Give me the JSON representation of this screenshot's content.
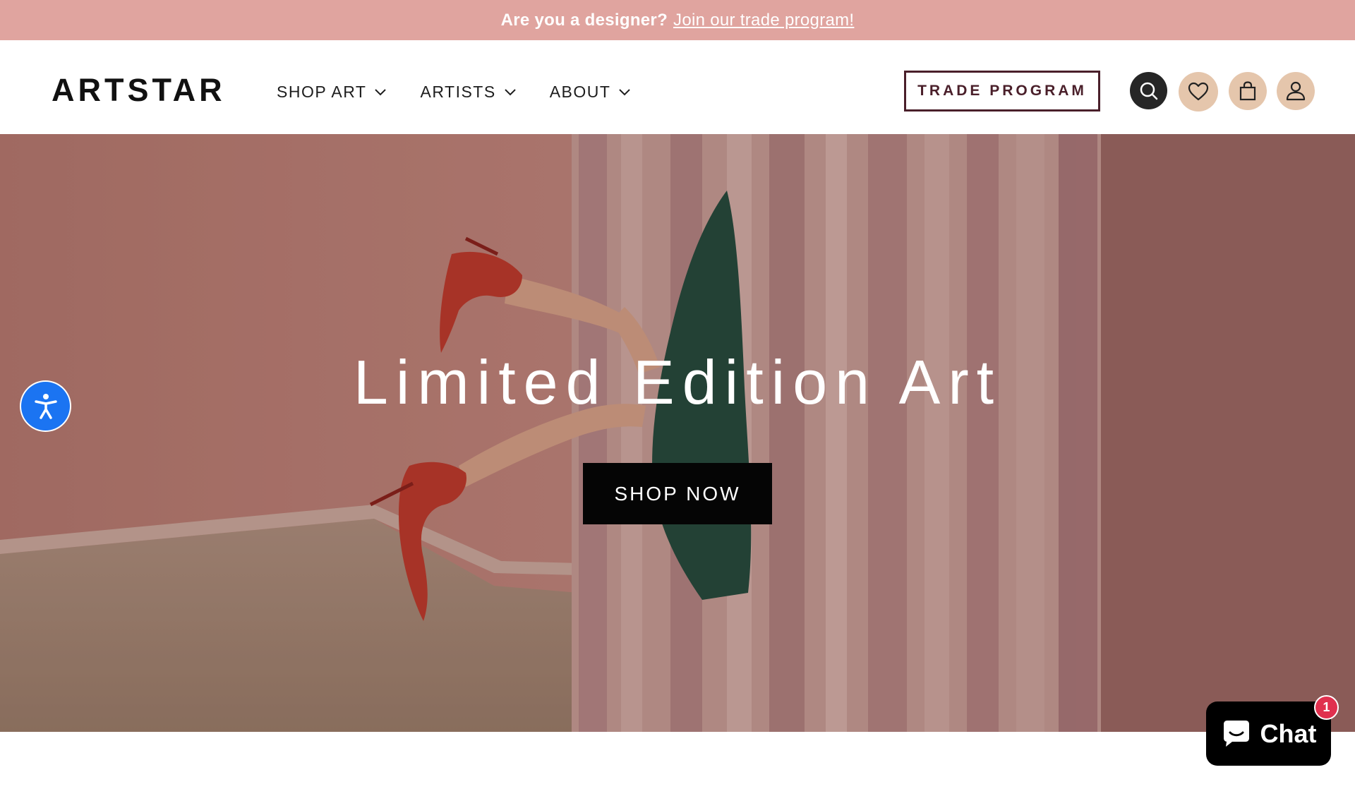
{
  "announcement": {
    "text": "Are you a designer?",
    "link": "Join our trade program!"
  },
  "header": {
    "logo": "ARTSTAR",
    "nav": [
      {
        "label": "SHOP ART"
      },
      {
        "label": "ARTISTS"
      },
      {
        "label": "ABOUT"
      }
    ],
    "trade_button": "TRADE PROGRAM",
    "icons": [
      "search-icon",
      "heart-icon",
      "bag-icon",
      "user-icon"
    ]
  },
  "hero": {
    "title": "Limited Edition Art",
    "cta": "SHOP NOW"
  },
  "chat": {
    "label": "Chat",
    "badge": "1"
  },
  "colors": {
    "announcement_bg": "#e0a49f",
    "trade_border": "#4a1f2a",
    "icon_bg": "#e5c6ac",
    "accessibility_blue": "#1b74f2",
    "chat_badge": "#e0304e"
  }
}
